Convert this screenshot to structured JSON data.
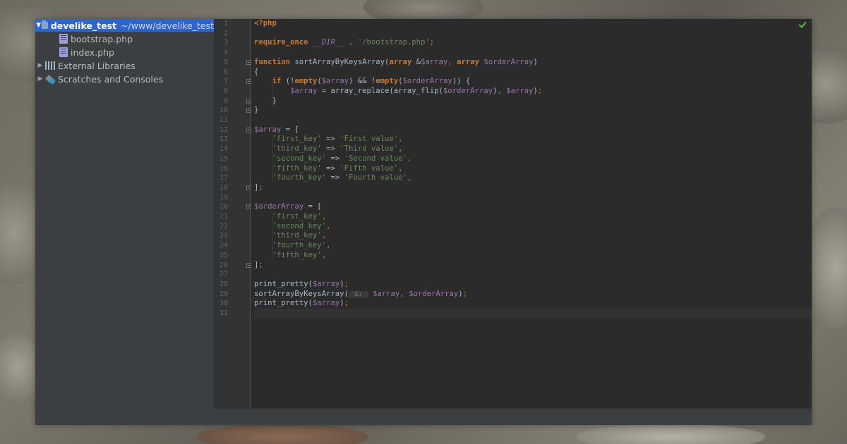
{
  "project_tree": {
    "root": {
      "name": "develike_test",
      "path": "~/www/develike_test"
    },
    "files": [
      "bootstrap.php",
      "index.php"
    ],
    "external_libraries": "External Libraries",
    "scratches": "Scratches and Consoles"
  },
  "editor": {
    "status_icon": "check-icon",
    "current_line": 31,
    "lines": [
      {
        "n": "1",
        "tokens": [
          {
            "t": "<?php",
            "c": "kw"
          }
        ]
      },
      {
        "n": "2",
        "tokens": []
      },
      {
        "n": "3",
        "tokens": [
          {
            "t": "require_once",
            "c": "kw"
          },
          {
            "t": " ",
            "c": ""
          },
          {
            "t": "__DIR__",
            "c": "const"
          },
          {
            "t": " . ",
            "c": ""
          },
          {
            "t": "'/bootstrap.php'",
            "c": "str"
          },
          {
            "t": ";",
            "c": "op"
          }
        ]
      },
      {
        "n": "4",
        "tokens": []
      },
      {
        "n": "5",
        "tokens": [
          {
            "t": "function",
            "c": "kw"
          },
          {
            "t": " sortArrayByKeysArray(",
            "c": "fn"
          },
          {
            "t": "array",
            "c": "kw"
          },
          {
            "t": " &",
            "c": ""
          },
          {
            "t": "$array",
            "c": "var"
          },
          {
            "t": ", ",
            "c": "op"
          },
          {
            "t": "array",
            "c": "kw"
          },
          {
            "t": " ",
            "c": ""
          },
          {
            "t": "$orderArray",
            "c": "var"
          },
          {
            "t": ")",
            "c": ""
          }
        ]
      },
      {
        "n": "6",
        "tokens": [
          {
            "t": "{",
            "c": ""
          }
        ]
      },
      {
        "n": "7",
        "tokens": [
          {
            "t": "    ",
            "c": ""
          },
          {
            "t": "if",
            "c": "kw"
          },
          {
            "t": " (!",
            "c": ""
          },
          {
            "t": "empty",
            "c": "kw"
          },
          {
            "t": "(",
            "c": ""
          },
          {
            "t": "$array",
            "c": "var"
          },
          {
            "t": ") && !",
            "c": ""
          },
          {
            "t": "empty",
            "c": "kw"
          },
          {
            "t": "(",
            "c": ""
          },
          {
            "t": "$orderArray",
            "c": "var"
          },
          {
            "t": ")) {",
            "c": ""
          }
        ]
      },
      {
        "n": "8",
        "tokens": [
          {
            "t": "        ",
            "c": ""
          },
          {
            "t": "$array",
            "c": "var"
          },
          {
            "t": " = array_replace(array_flip(",
            "c": ""
          },
          {
            "t": "$orderArray",
            "c": "var"
          },
          {
            "t": ")",
            "c": ""
          },
          {
            "t": ", ",
            "c": "op"
          },
          {
            "t": "$array",
            "c": "var"
          },
          {
            "t": ")",
            "c": ""
          },
          {
            "t": ";",
            "c": "op"
          }
        ]
      },
      {
        "n": "9",
        "tokens": [
          {
            "t": "    }",
            "c": ""
          }
        ]
      },
      {
        "n": "10",
        "tokens": [
          {
            "t": "}",
            "c": ""
          }
        ]
      },
      {
        "n": "11",
        "tokens": []
      },
      {
        "n": "12",
        "tokens": [
          {
            "t": "$array",
            "c": "var"
          },
          {
            "t": " = [",
            "c": ""
          }
        ]
      },
      {
        "n": "13",
        "tokens": [
          {
            "t": "    ",
            "c": ""
          },
          {
            "t": "'first_key'",
            "c": "str"
          },
          {
            "t": " => ",
            "c": ""
          },
          {
            "t": "'First value'",
            "c": "str"
          },
          {
            "t": ",",
            "c": "op"
          }
        ]
      },
      {
        "n": "14",
        "tokens": [
          {
            "t": "    ",
            "c": ""
          },
          {
            "t": "'third_key'",
            "c": "str"
          },
          {
            "t": " => ",
            "c": ""
          },
          {
            "t": "'Third value'",
            "c": "str"
          },
          {
            "t": ",",
            "c": "op"
          }
        ]
      },
      {
        "n": "15",
        "tokens": [
          {
            "t": "    ",
            "c": ""
          },
          {
            "t": "'second_key'",
            "c": "str"
          },
          {
            "t": " => ",
            "c": ""
          },
          {
            "t": "'Second value'",
            "c": "str"
          },
          {
            "t": ",",
            "c": "op"
          }
        ]
      },
      {
        "n": "16",
        "tokens": [
          {
            "t": "    ",
            "c": ""
          },
          {
            "t": "'fifth_key'",
            "c": "str"
          },
          {
            "t": " => ",
            "c": ""
          },
          {
            "t": "'Fifth value'",
            "c": "str"
          },
          {
            "t": ",",
            "c": "op"
          }
        ]
      },
      {
        "n": "17",
        "tokens": [
          {
            "t": "    ",
            "c": ""
          },
          {
            "t": "'fourth_key'",
            "c": "str"
          },
          {
            "t": " => ",
            "c": ""
          },
          {
            "t": "'Fourth value'",
            "c": "str"
          },
          {
            "t": ",",
            "c": "op"
          }
        ]
      },
      {
        "n": "18",
        "tokens": [
          {
            "t": "]",
            "c": ""
          },
          {
            "t": ";",
            "c": "op"
          }
        ]
      },
      {
        "n": "19",
        "tokens": []
      },
      {
        "n": "20",
        "tokens": [
          {
            "t": "$orderArray",
            "c": "var"
          },
          {
            "t": " = [",
            "c": ""
          }
        ]
      },
      {
        "n": "21",
        "tokens": [
          {
            "t": "    ",
            "c": ""
          },
          {
            "t": "'first_key'",
            "c": "str"
          },
          {
            "t": ",",
            "c": "op"
          }
        ]
      },
      {
        "n": "22",
        "tokens": [
          {
            "t": "    ",
            "c": ""
          },
          {
            "t": "'second_key'",
            "c": "str"
          },
          {
            "t": ",",
            "c": "op"
          }
        ]
      },
      {
        "n": "23",
        "tokens": [
          {
            "t": "    ",
            "c": ""
          },
          {
            "t": "'third_key'",
            "c": "str"
          },
          {
            "t": ",",
            "c": "op"
          }
        ]
      },
      {
        "n": "24",
        "tokens": [
          {
            "t": "    ",
            "c": ""
          },
          {
            "t": "'fourth_key'",
            "c": "str"
          },
          {
            "t": ",",
            "c": "op"
          }
        ]
      },
      {
        "n": "25",
        "tokens": [
          {
            "t": "    ",
            "c": ""
          },
          {
            "t": "'fifth_key'",
            "c": "str"
          },
          {
            "t": ",",
            "c": "op"
          }
        ]
      },
      {
        "n": "26",
        "tokens": [
          {
            "t": "]",
            "c": ""
          },
          {
            "t": ";",
            "c": "op"
          }
        ]
      },
      {
        "n": "27",
        "tokens": []
      },
      {
        "n": "28",
        "tokens": [
          {
            "t": "print_pretty(",
            "c": ""
          },
          {
            "t": "$array",
            "c": "var"
          },
          {
            "t": ")",
            "c": ""
          },
          {
            "t": ";",
            "c": "op"
          }
        ]
      },
      {
        "n": "29",
        "tokens": [
          {
            "t": "sortArrayByKeysArray(",
            "c": ""
          },
          {
            "t": " &: ",
            "c": "hint"
          },
          {
            "t": " ",
            "c": ""
          },
          {
            "t": "$array",
            "c": "var"
          },
          {
            "t": ", ",
            "c": "op"
          },
          {
            "t": "$orderArray",
            "c": "var"
          },
          {
            "t": ")",
            "c": ""
          },
          {
            "t": ";",
            "c": "op"
          }
        ]
      },
      {
        "n": "30",
        "tokens": [
          {
            "t": "print_pretty(",
            "c": ""
          },
          {
            "t": "$array",
            "c": "var"
          },
          {
            "t": ")",
            "c": ""
          },
          {
            "t": ";",
            "c": "op"
          }
        ]
      },
      {
        "n": "31",
        "tokens": []
      }
    ],
    "folds": [
      5,
      7,
      9,
      10,
      12,
      18,
      20,
      26
    ]
  }
}
